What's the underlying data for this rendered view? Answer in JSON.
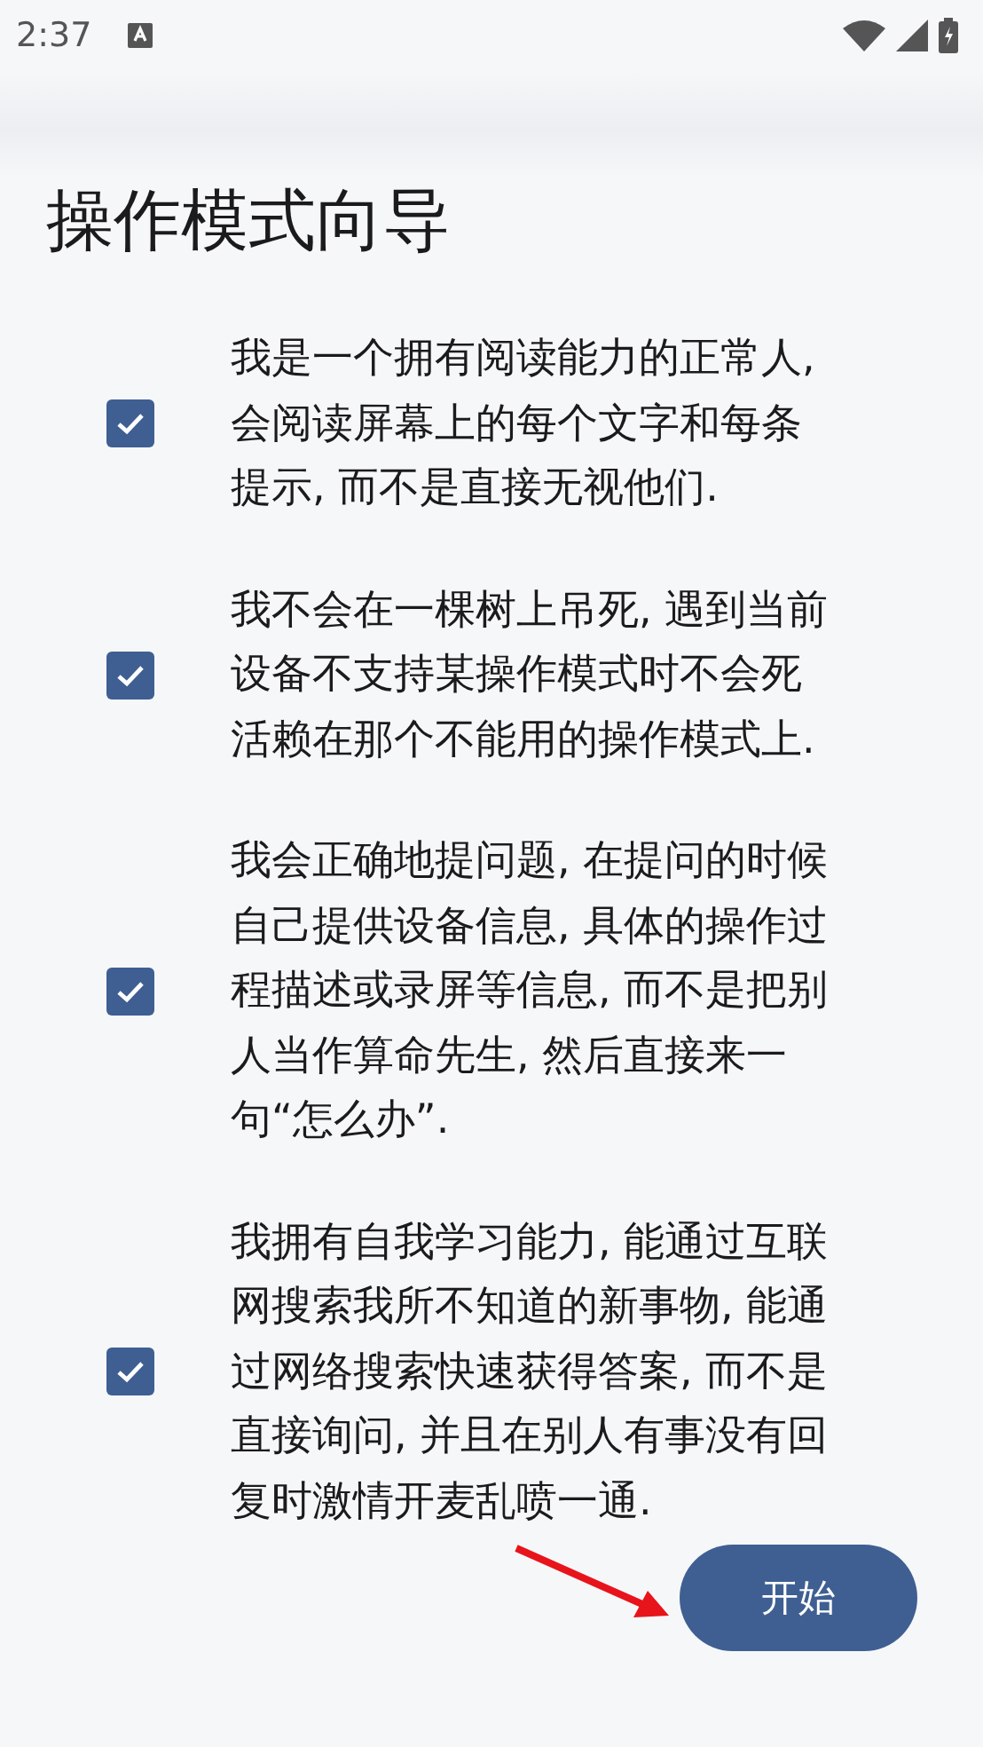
{
  "status_bar": {
    "time": "2:37"
  },
  "title": "操作模式向导",
  "items": [
    {
      "text": "我是一个拥有阅读能力的正常人, 会阅读屏幕上的每个文字和每条提示, 而不是直接无视他们.",
      "checked": true
    },
    {
      "text": "我不会在一棵树上吊死, 遇到当前设备不支持某操作模式时不会死活赖在那个不能用的操作模式上.",
      "checked": true
    },
    {
      "text": "我会正确地提问题, 在提问的时候自己提供设备信息, 具体的操作过程描述或录屏等信息, 而不是把别人当作算命先生, 然后直接来一句“怎么办”.",
      "checked": true
    },
    {
      "text": "我拥有自我学习能力, 能通过互联网搜索我所不知道的新事物, 能通过网络搜索快速获得答案, 而不是直接询问, 并且在别人有事没有回复时激情开麦乱喷一通.",
      "checked": true
    }
  ],
  "start_button": {
    "label": "开始"
  }
}
